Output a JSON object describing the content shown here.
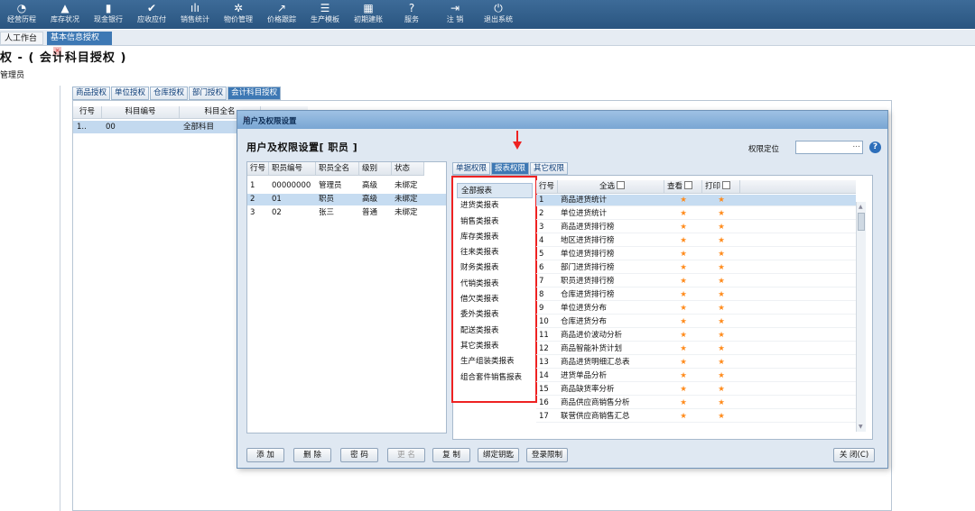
{
  "nav": [
    {
      "icon": "◔",
      "icon_name": "chart-pie-icon",
      "label": "经营历程"
    },
    {
      "icon": "▲",
      "icon_name": "home-icon",
      "label": "库存状况"
    },
    {
      "icon": "▮",
      "icon_name": "book-icon",
      "label": "现金银行"
    },
    {
      "icon": "✔",
      "icon_name": "check-circle-icon",
      "label": "应收应付"
    },
    {
      "icon": "ılı",
      "icon_name": "bar-chart-icon",
      "label": "销售统计"
    },
    {
      "icon": "✲",
      "icon_name": "asterisk-icon",
      "label": "物价管理"
    },
    {
      "icon": "↗",
      "icon_name": "arrow-icon",
      "label": "价格跟踪"
    },
    {
      "icon": "☰",
      "icon_name": "list-icon",
      "label": "生产模板"
    },
    {
      "icon": "▦",
      "icon_name": "grid-icon",
      "label": "初期建账"
    },
    {
      "icon": "?",
      "icon_name": "help-icon",
      "label": "服务"
    },
    {
      "icon": "⇥",
      "icon_name": "logout-icon",
      "label": "注 销"
    },
    {
      "icon": "⏻",
      "icon_name": "power-icon",
      "label": "退出系统"
    }
  ],
  "page_tabs": {
    "workbench": "人工作台",
    "active": "基本信息授权",
    "close": "×"
  },
  "page_title": "权 - ( 会计科目授权 )",
  "page_user": "管理员",
  "bg_tabs": [
    "商品授权",
    "单位授权",
    "仓库授权",
    "部门授权",
    "会计科目授权"
  ],
  "bg_table": {
    "headers": [
      "行号",
      "科目编号",
      "科目全名"
    ],
    "rows": [
      [
        "1..",
        "00",
        "全部科目"
      ]
    ]
  },
  "dialog": {
    "title": "用户及权限设置",
    "close": "×",
    "heading": "用户及权限设置[ 职员 ]",
    "perm_label": "权限定位",
    "perm_value": "",
    "perm_dots": "...",
    "help": "?"
  },
  "staff": {
    "headers": [
      "行号",
      "职员编号",
      "职员全名",
      "级别",
      "状态"
    ],
    "rows": [
      [
        "1",
        "00000000",
        "管理员",
        "高级",
        "未绑定"
      ],
      [
        "2",
        "01",
        "职员",
        "高级",
        "未绑定"
      ],
      [
        "3",
        "02",
        "张三",
        "普通",
        "未绑定"
      ]
    ]
  },
  "right_tabs": [
    "单据权限",
    "报表权限",
    "其它权限"
  ],
  "categories": [
    "全部报表",
    "进货类报表",
    "销售类报表",
    "库存类报表",
    "往来类报表",
    "财务类报表",
    "代销类报表",
    "借欠类报表",
    "委外类报表",
    "配送类报表",
    "其它类报表",
    "生产组装类报表",
    "组合套件销售报表"
  ],
  "report_grid": {
    "headers": [
      "行号",
      "全选",
      "查看",
      "打印"
    ],
    "star": "★",
    "rows": [
      [
        "1",
        "商品进货统计"
      ],
      [
        "2",
        "单位进货统计"
      ],
      [
        "3",
        "商品进货排行榜"
      ],
      [
        "4",
        "地区进货排行榜"
      ],
      [
        "5",
        "单位进货排行榜"
      ],
      [
        "6",
        "部门进货排行榜"
      ],
      [
        "7",
        "职员进货排行榜"
      ],
      [
        "8",
        "仓库进货排行榜"
      ],
      [
        "9",
        "单位进货分布"
      ],
      [
        "10",
        "仓库进货分布"
      ],
      [
        "11",
        "商品进价波动分析"
      ],
      [
        "12",
        "商品智能补货计划"
      ],
      [
        "13",
        "商品进货明细汇总表"
      ],
      [
        "14",
        "进货单品分析"
      ],
      [
        "15",
        "商品缺货率分析"
      ],
      [
        "16",
        "商品供应商销售分析"
      ],
      [
        "17",
        "联营供应商销售汇总"
      ]
    ]
  },
  "buttons": [
    "添 加",
    "删 除",
    "密 码",
    "更 名",
    "复 制",
    "绑定钥匙",
    "登录限制",
    "关 闭(C)"
  ]
}
